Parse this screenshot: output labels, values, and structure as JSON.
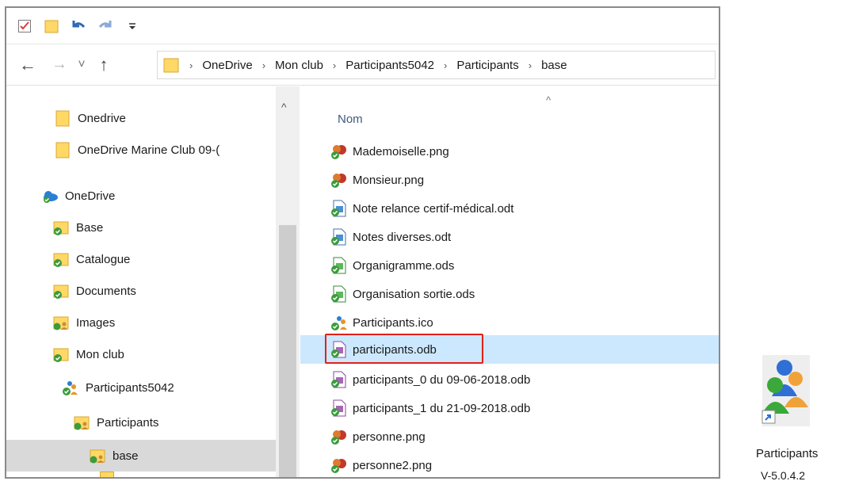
{
  "quick_access": {
    "icons": [
      "properties-icon",
      "new-folder-icon",
      "undo-icon",
      "redo-icon",
      "customize-dropdown-icon"
    ],
    "customize_glyph": "⩦"
  },
  "nav": {
    "back_glyph": "←",
    "forward_glyph": "→",
    "recent_glyph": "˅",
    "up_glyph": "↑"
  },
  "breadcrumbs": [
    "OneDrive",
    "Mon club",
    "Participants5042",
    "Participants",
    "base"
  ],
  "breadcrumb_separator": "›",
  "nav_pane": {
    "scroll_up_glyph": "^",
    "items": [
      {
        "label": "Onedrive",
        "icon": "folder-icon"
      },
      {
        "label": "OneDrive Marine Club 09-(",
        "icon": "folder-icon"
      },
      {
        "label": "OneDrive",
        "icon": "onedrive-cloud-icon"
      },
      {
        "label": "Base",
        "icon": "synced-folder-icon"
      },
      {
        "label": "Catalogue",
        "icon": "synced-folder-icon"
      },
      {
        "label": "Documents",
        "icon": "synced-folder-icon"
      },
      {
        "label": "Images",
        "icon": "shared-folder-icon"
      },
      {
        "label": "Mon club",
        "icon": "synced-folder-icon"
      },
      {
        "label": "Participants5042",
        "icon": "participants-folder-icon"
      },
      {
        "label": "Participants",
        "icon": "shared-folder-icon"
      },
      {
        "label": "base",
        "icon": "shared-folder-icon"
      }
    ]
  },
  "file_list": {
    "column_name": "Nom",
    "sort_glyph": "^",
    "files": [
      {
        "name": "Mademoiselle.png",
        "icon": "png-file-icon"
      },
      {
        "name": "Monsieur.png",
        "icon": "png-file-icon"
      },
      {
        "name": "Note relance certif-médical.odt",
        "icon": "odt-file-icon"
      },
      {
        "name": "Notes diverses.odt",
        "icon": "odt-file-icon"
      },
      {
        "name": "Organigramme.ods",
        "icon": "ods-file-icon"
      },
      {
        "name": "Organisation sortie.ods",
        "icon": "ods-file-icon"
      },
      {
        "name": "Participants.ico",
        "icon": "ico-file-icon"
      },
      {
        "name": "participants.odb",
        "icon": "odb-file-icon"
      },
      {
        "name": "participants_0 du 09-06-2018.odb",
        "icon": "odb-file-icon"
      },
      {
        "name": "participants_1 du 21-09-2018.odb",
        "icon": "odb-file-icon"
      },
      {
        "name": "personne.png",
        "icon": "png-file-icon"
      },
      {
        "name": "personne2.png",
        "icon": "png-file-icon"
      }
    ]
  },
  "desktop_shortcut": {
    "name": "Participants",
    "version": "V-5.0.4.2"
  },
  "colors": {
    "selection_row": "#cce8ff",
    "nav_selected": "#d9d9d9",
    "highlight_border": "#e0201a",
    "folder_yellow": "#ffd866",
    "sync_green": "#3a9c3a",
    "onedrive_blue": "#2a7fd4"
  }
}
